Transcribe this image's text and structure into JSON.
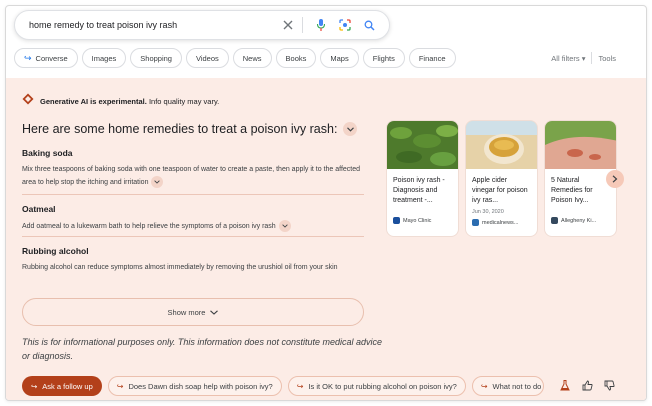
{
  "search": {
    "query": "home remedy to treat poison ivy rash"
  },
  "chips": [
    {
      "label": "Converse"
    },
    {
      "label": "Images"
    },
    {
      "label": "Shopping"
    },
    {
      "label": "Videos"
    },
    {
      "label": "News"
    },
    {
      "label": "Books"
    },
    {
      "label": "Maps"
    },
    {
      "label": "Flights"
    },
    {
      "label": "Finance"
    }
  ],
  "filters": {
    "all_filters": "All filters",
    "tools": "Tools"
  },
  "ai": {
    "experimental_bold": "Generative AI is experimental.",
    "experimental_rest": " Info quality may vary.",
    "heading": "Here are some home remedies to treat a poison ivy rash:",
    "sections": [
      {
        "title": "Baking soda",
        "body": "Mix three teaspoons of baking soda with one teaspoon of water to create a paste, then apply it to the affected area to help stop the itching and irritation"
      },
      {
        "title": "Oatmeal",
        "body": "Add oatmeal to a lukewarm bath to help relieve the symptoms of a poison ivy rash"
      },
      {
        "title": "Rubbing alcohol",
        "body": "Rubbing alcohol can reduce symptoms almost immediately by removing the urushiol oil from your skin"
      }
    ],
    "show_more": "Show more",
    "disclaimer": "This is for informational purposes only. This information does not constitute medical advice or diagnosis."
  },
  "cards": [
    {
      "title": "Poison ivy rash - Diagnosis and treatment -...",
      "date": "",
      "source": "Mayo Clinic",
      "img_color": "#4e7a2c",
      "fav_color": "#1a4f9c"
    },
    {
      "title": "Apple cider vinegar for poison ivy ras...",
      "date": "Jun 30, 2020",
      "source": "medicalnews...",
      "img_color": "#d9b97a",
      "fav_color": "#2b6cb0"
    },
    {
      "title": "5 Natural Remedies for Poison Ivy...",
      "date": "",
      "source": "Allegheny Ki...",
      "img_color": "#c98a74",
      "fav_color": "#34495e"
    }
  ],
  "bottom": {
    "ask": "Ask a follow up",
    "followups": [
      "Does Dawn dish soap help with poison ivy?",
      "Is it OK to put rubbing alcohol on poison ivy?",
      "What not to do"
    ]
  },
  "colors": {
    "panel_bg": "#fcece6",
    "accent": "#b3401a",
    "link_blue": "#1a73e8"
  }
}
